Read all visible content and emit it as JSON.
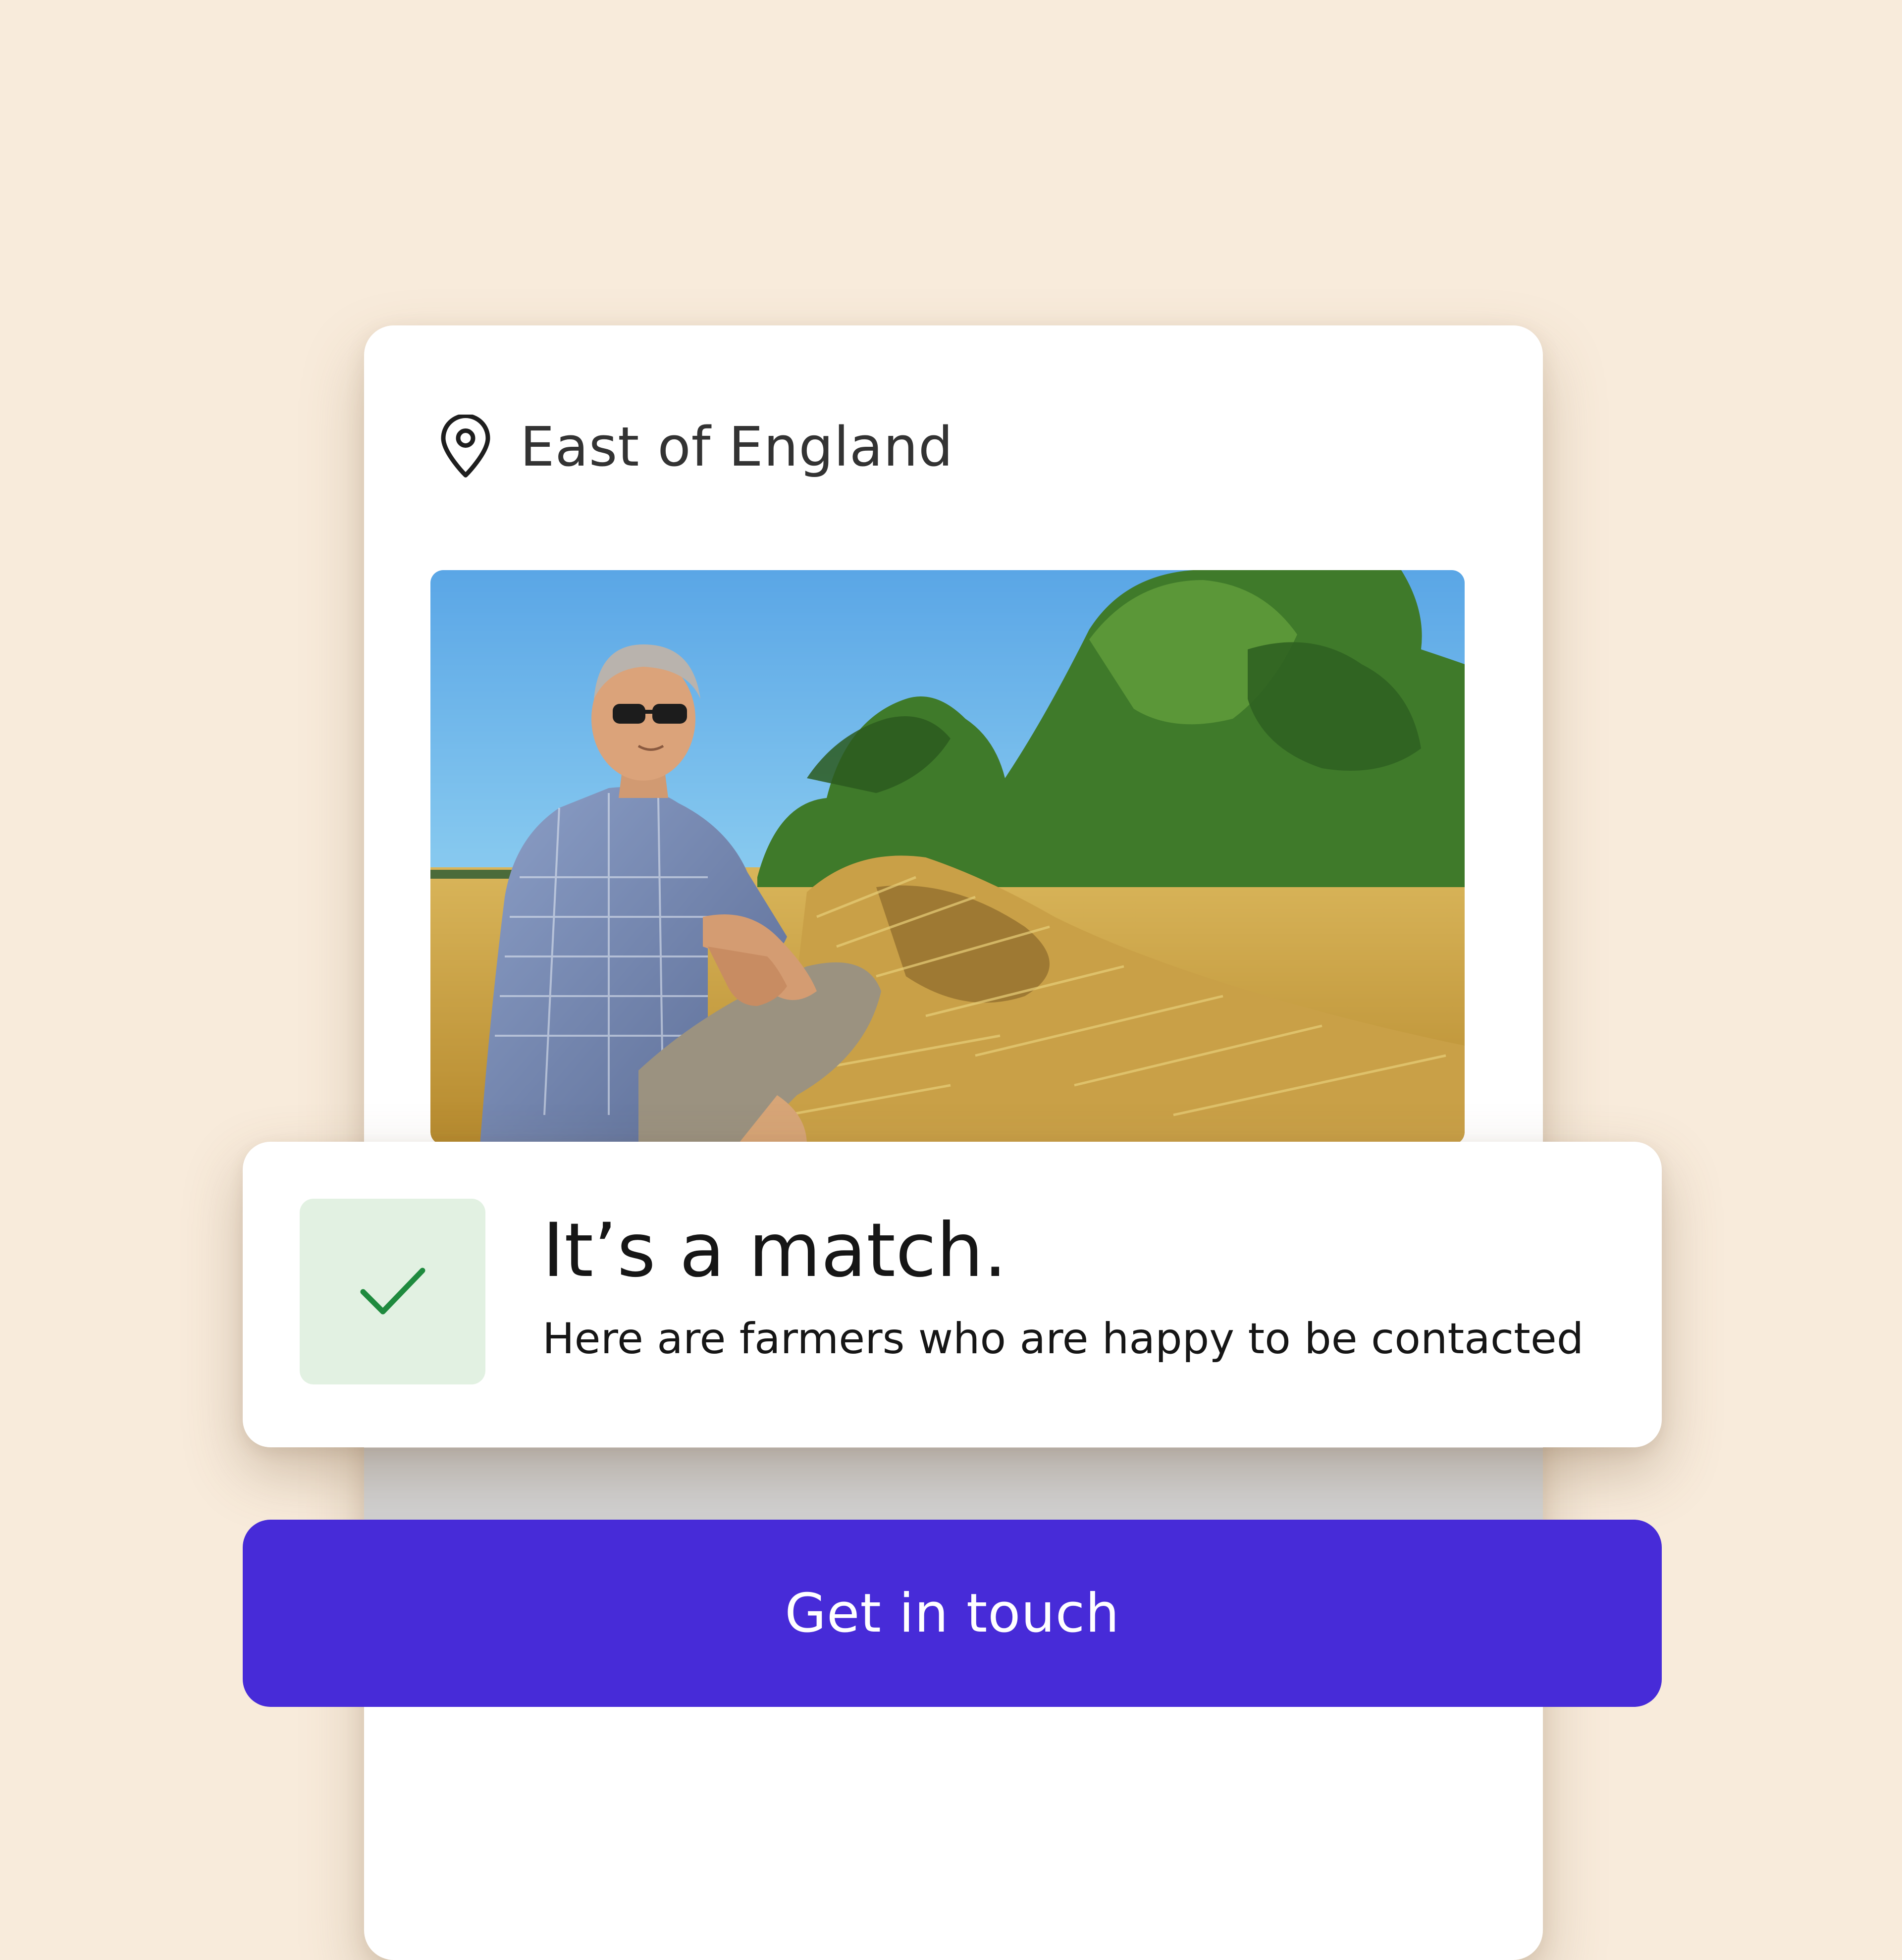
{
  "location": {
    "icon": "map-pin-icon",
    "label": "East of England"
  },
  "photo": {
    "description_icon": "farmer-photo"
  },
  "match": {
    "icon": "checkmark-icon",
    "title": "It’s a match.",
    "subtitle": "Here are farmers who are happy to be contacted"
  },
  "cta": {
    "label": "Get in touch"
  },
  "colors": {
    "background": "#f8ebdb",
    "button": "#472bd8",
    "check_bg": "#e2f1e2",
    "check_stroke": "#1f8a3e"
  }
}
